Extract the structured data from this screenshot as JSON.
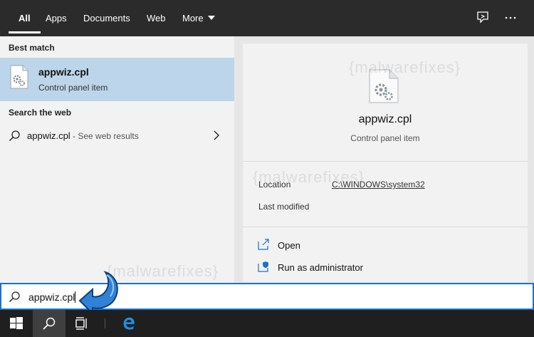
{
  "tabs": [
    {
      "label": "All",
      "active": true
    },
    {
      "label": "Apps"
    },
    {
      "label": "Documents"
    },
    {
      "label": "Web"
    },
    {
      "label": "More"
    }
  ],
  "top_icons": [
    "feedback-icon",
    "more-options-icon"
  ],
  "left": {
    "best_match_heading": "Best match",
    "best_match": {
      "title": "appwiz.cpl",
      "subtitle": "Control panel item",
      "icon": "control-panel-file-icon"
    },
    "web_heading": "Search the web",
    "web_result": {
      "query": "appwiz.cpl",
      "suffix": " - See web results"
    }
  },
  "right": {
    "title": "appwiz.cpl",
    "subtitle": "Control panel item",
    "location_label": "Location",
    "location_value": "C:\\WINDOWS\\system32",
    "last_modified_label": "Last modified",
    "actions": [
      {
        "label": "Open",
        "icon": "open-icon"
      },
      {
        "label": "Run as administrator",
        "icon": "shield-icon"
      }
    ]
  },
  "watermark": "{malwarefixes}",
  "search": {
    "value": "appwiz.cpl"
  },
  "taskbar": [
    "windows-start-icon",
    "search-icon",
    "task-view-icon",
    "edge-icon"
  ],
  "colors": {
    "selected": "#bcd5ea",
    "accent": "#1a73c7",
    "topbar": "#2b2b2b"
  }
}
